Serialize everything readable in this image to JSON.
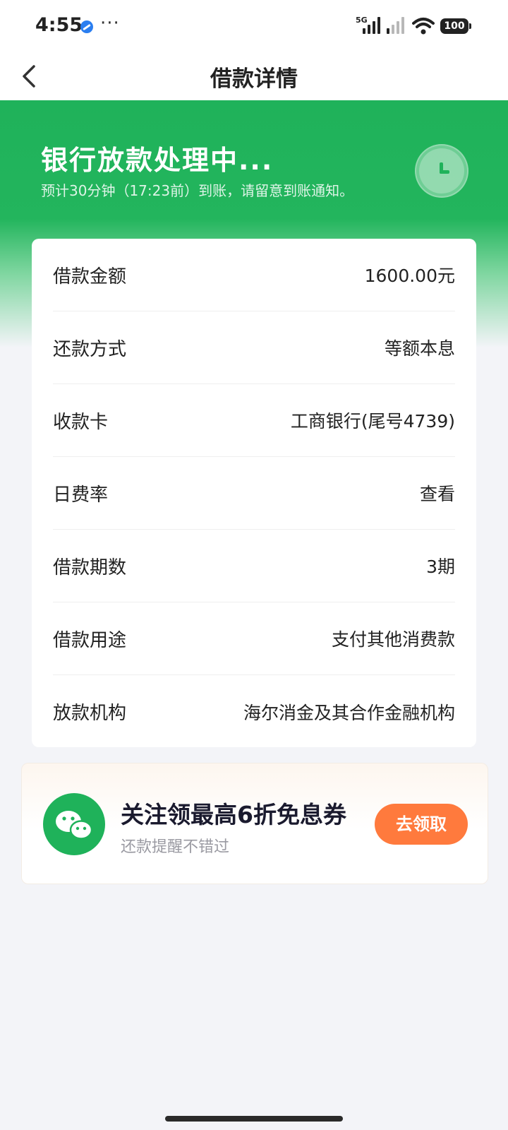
{
  "status_bar": {
    "time": "4:55",
    "dots": "···",
    "network_label": "5G",
    "battery": "100"
  },
  "navbar": {
    "title": "借款详情"
  },
  "hero": {
    "title": "银行放款处理中...",
    "subtitle": "预计30分钟（17:23前）到账，请留意到账通知。"
  },
  "details": {
    "rows": [
      {
        "label": "借款金额",
        "value": "1600.00元"
      },
      {
        "label": "还款方式",
        "value": "等额本息"
      },
      {
        "label": "收款卡",
        "value": "工商银行(尾号4739)"
      },
      {
        "label": "日费率",
        "value": "查看"
      },
      {
        "label": "借款期数",
        "value": "3期"
      },
      {
        "label": "借款用途",
        "value": "支付其他消费款"
      },
      {
        "label": "放款机构",
        "value": "海尔消金及其合作金融机构"
      }
    ]
  },
  "promo": {
    "title": "关注领最高6折免息券",
    "subtitle": "还款提醒不错过",
    "button_label": "去领取"
  },
  "colors": {
    "brand_green": "#1fb25a",
    "accent_orange": "#ff7a3d",
    "background": "#f3f4f8"
  },
  "icons": [
    "back-arrow-icon",
    "clock-icon",
    "wechat-icon",
    "signal-icon",
    "wifi-icon",
    "battery-icon"
  ]
}
